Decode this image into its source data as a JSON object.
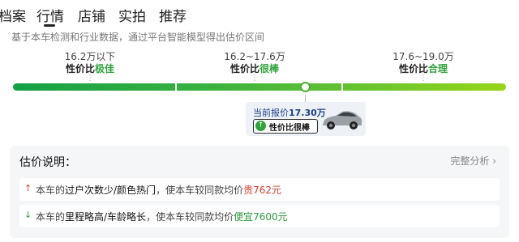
{
  "tabs": [
    {
      "label": "档案"
    },
    {
      "label": "行情"
    },
    {
      "label": "店铺"
    },
    {
      "label": "实拍"
    },
    {
      "label": "推荐"
    }
  ],
  "subtitle": "基于本车检测和行业数据，通过平台智能模型得出估价区间",
  "markers": [
    {
      "price": "16.2万以下",
      "level_prefix": "性价比",
      "level_value": "极佳"
    },
    {
      "price": "16.2~17.6万",
      "level_prefix": "性价比",
      "level_value": "很棒"
    },
    {
      "price": "17.6~19.0万",
      "level_prefix": "性价比",
      "level_value": "合理"
    }
  ],
  "marker_colors": [
    "#2fa33b",
    "#2fa33b",
    "#2fa33b"
  ],
  "current": {
    "label": "当前报价",
    "value": "17.30万",
    "badge": "性价比很棒",
    "position_fraction": 0.59
  },
  "explain": {
    "title": "估价说明：",
    "more": "完整分析",
    "items": [
      {
        "direction": "up",
        "text_a": "本车的",
        "text_b": "过户次数少/颜色热门",
        "text_c": "，使本车较同款均价",
        "text_d": "贵762元"
      },
      {
        "direction": "down",
        "text_a": "本车的",
        "text_b": "里程略高/车龄略长",
        "text_c": "，使本车较同款均价",
        "text_d": "便宜7600元"
      }
    ]
  },
  "colors": {
    "up": "#d63c2a",
    "down": "#2b9a3b",
    "brand": "#2fa33b",
    "current_text": "#1a3f8a"
  }
}
